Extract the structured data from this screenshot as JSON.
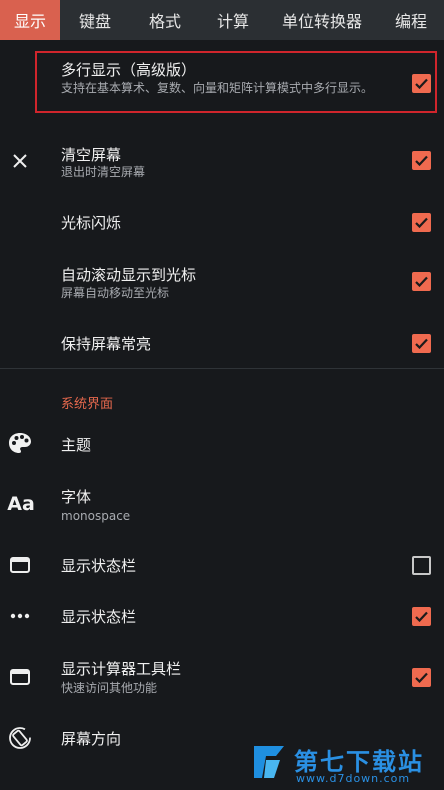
{
  "tabs": [
    {
      "label": "显示",
      "active": true
    },
    {
      "label": "键盘",
      "active": false
    },
    {
      "label": "格式",
      "active": false
    },
    {
      "label": "计算",
      "active": false
    },
    {
      "label": "单位转换器",
      "active": false
    },
    {
      "label": "编程",
      "active": false
    }
  ],
  "settings": {
    "multiline": {
      "title": "多行显示（高级版）",
      "subtitle": "支持在基本算术、复数、向量和矩阵计算模式中多行显示。",
      "checked": true
    },
    "clear_screen": {
      "title": "清空屏幕",
      "subtitle": "退出时清空屏幕",
      "checked": true,
      "icon": "close-icon"
    },
    "cursor_blink": {
      "title": "光标闪烁",
      "checked": true
    },
    "auto_scroll": {
      "title": "自动滚动显示到光标",
      "subtitle": "屏幕自动移动至光标",
      "checked": true
    },
    "keep_screen_on": {
      "title": "保持屏幕常亮",
      "checked": true
    }
  },
  "system_section": {
    "header": "系统界面",
    "theme": {
      "title": "主题",
      "icon": "palette-icon"
    },
    "font": {
      "title": "字体",
      "subtitle": "monospace",
      "icon": "font-icon",
      "icon_text": "Aa"
    },
    "status_bar_1": {
      "title": "显示状态栏",
      "checked": false,
      "icon": "window-icon"
    },
    "status_bar_2": {
      "title": "显示状态栏",
      "checked": true,
      "icon": "more-dots-icon"
    },
    "toolbar": {
      "title": "显示计算器工具栏",
      "subtitle": "快速访问其他功能",
      "checked": true,
      "icon": "window-icon"
    },
    "orientation": {
      "title": "屏幕方向",
      "icon": "screen-rotation-icon"
    }
  },
  "watermark": {
    "brand": "第七下载站",
    "url": "www.d7down.com"
  },
  "colors": {
    "accent": "#ef6a4f",
    "active_tab": "#d9614f",
    "background": "#17191c",
    "tabbar": "#2b2f33",
    "highlight_border": "#d0252c"
  }
}
